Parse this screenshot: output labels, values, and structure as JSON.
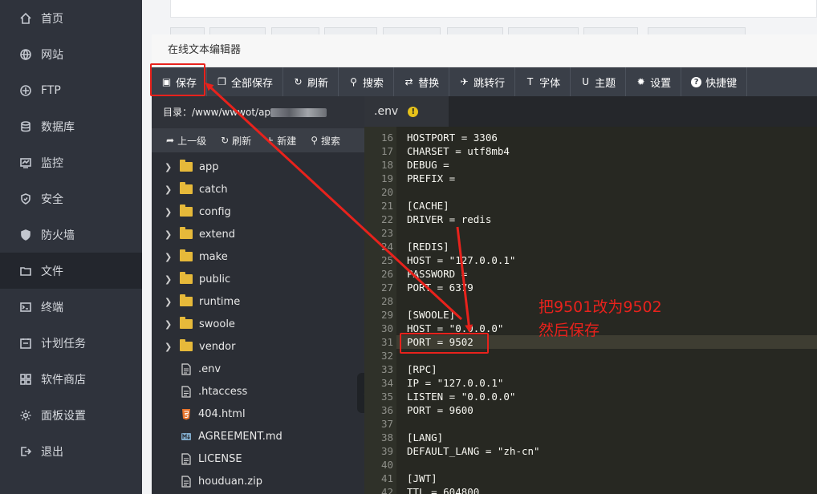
{
  "sidebar": {
    "items": [
      {
        "label": "首页",
        "icon": "home-icon"
      },
      {
        "label": "网站",
        "icon": "globe-icon"
      },
      {
        "label": "FTP",
        "icon": "ftp-icon"
      },
      {
        "label": "数据库",
        "icon": "database-icon"
      },
      {
        "label": "监控",
        "icon": "monitor-icon"
      },
      {
        "label": "安全",
        "icon": "shield-icon"
      },
      {
        "label": "防火墙",
        "icon": "firewall-icon"
      },
      {
        "label": "文件",
        "icon": "folder-icon",
        "active": true
      },
      {
        "label": "终端",
        "icon": "terminal-icon"
      },
      {
        "label": "计划任务",
        "icon": "clock-icon"
      },
      {
        "label": "软件商店",
        "icon": "grid-icon"
      },
      {
        "label": "面板设置",
        "icon": "gear-icon"
      },
      {
        "label": "退出",
        "icon": "logout-icon"
      }
    ]
  },
  "dialog": {
    "title": "在线文本编辑器",
    "toolbar": [
      {
        "label": "保存",
        "icon": "save-icon"
      },
      {
        "label": "全部保存",
        "icon": "save-all-icon"
      },
      {
        "label": "刷新",
        "icon": "refresh-icon"
      },
      {
        "label": "搜索",
        "icon": "search-icon"
      },
      {
        "label": "替换",
        "icon": "replace-icon"
      },
      {
        "label": "跳转行",
        "icon": "goto-line-icon"
      },
      {
        "label": "字体",
        "icon": "font-icon"
      },
      {
        "label": "主题",
        "icon": "theme-icon"
      },
      {
        "label": "设置",
        "icon": "gear-icon"
      },
      {
        "label": "快捷键",
        "icon": "help-icon"
      }
    ]
  },
  "filepanel": {
    "dir_label": "目录：/www/www",
    "dir_suffix": "ot/ap",
    "tools": [
      {
        "label": "上一级",
        "icon": "up-icon"
      },
      {
        "label": "刷新",
        "icon": "refresh-icon"
      },
      {
        "label": "新建",
        "icon": "plus-icon"
      },
      {
        "label": "搜索",
        "icon": "search-icon"
      }
    ],
    "folders": [
      "app",
      "catch",
      "config",
      "extend",
      "make",
      "public",
      "runtime",
      "swoole",
      "vendor"
    ],
    "files": [
      {
        "name": ".env",
        "icon": "file-icon"
      },
      {
        "name": ".htaccess",
        "icon": "file-icon"
      },
      {
        "name": "404.html",
        "icon": "html5-icon"
      },
      {
        "name": "AGREEMENT.md",
        "icon": "markdown-icon"
      },
      {
        "name": "LICENSE",
        "icon": "file-icon"
      },
      {
        "name": "houduan.zip",
        "icon": "file-icon"
      }
    ]
  },
  "editor": {
    "tab_label": ".env",
    "tab_warning": "!",
    "lines": [
      {
        "n": "16",
        "t": "HOSTPORT = 3306"
      },
      {
        "n": "17",
        "t": "CHARSET = utf8mb4"
      },
      {
        "n": "18",
        "t": "DEBUG = "
      },
      {
        "n": "19",
        "t": "PREFIX = "
      },
      {
        "n": "20",
        "t": ""
      },
      {
        "n": "21",
        "t": "[CACHE]"
      },
      {
        "n": "22",
        "t": "DRIVER = redis"
      },
      {
        "n": "23",
        "t": ""
      },
      {
        "n": "24",
        "t": "[REDIS]"
      },
      {
        "n": "25",
        "t": "HOST = \"127.0.0.1\""
      },
      {
        "n": "26",
        "t": "PASSWORD = "
      },
      {
        "n": "27",
        "t": "PORT = 6379"
      },
      {
        "n": "28",
        "t": ""
      },
      {
        "n": "29",
        "t": "[SWOOLE]"
      },
      {
        "n": "30",
        "t": "HOST = \"0.0.0.0\""
      },
      {
        "n": "31",
        "t": "PORT = 9502",
        "active": true
      },
      {
        "n": "32",
        "t": ""
      },
      {
        "n": "33",
        "t": "[RPC]"
      },
      {
        "n": "34",
        "t": "IP = \"127.0.0.1\""
      },
      {
        "n": "35",
        "t": "LISTEN = \"0.0.0.0\""
      },
      {
        "n": "36",
        "t": "PORT = 9600"
      },
      {
        "n": "37",
        "t": ""
      },
      {
        "n": "38",
        "t": "[LANG]"
      },
      {
        "n": "39",
        "t": "DEFAULT_LANG = \"zh-cn\""
      },
      {
        "n": "40",
        "t": ""
      },
      {
        "n": "41",
        "t": "[JWT]"
      },
      {
        "n": "42",
        "t": "TTL = 604800"
      }
    ]
  },
  "annotation": {
    "line1": "把9501改为9502",
    "line2": "然后保存",
    "color": "#e8221c"
  }
}
